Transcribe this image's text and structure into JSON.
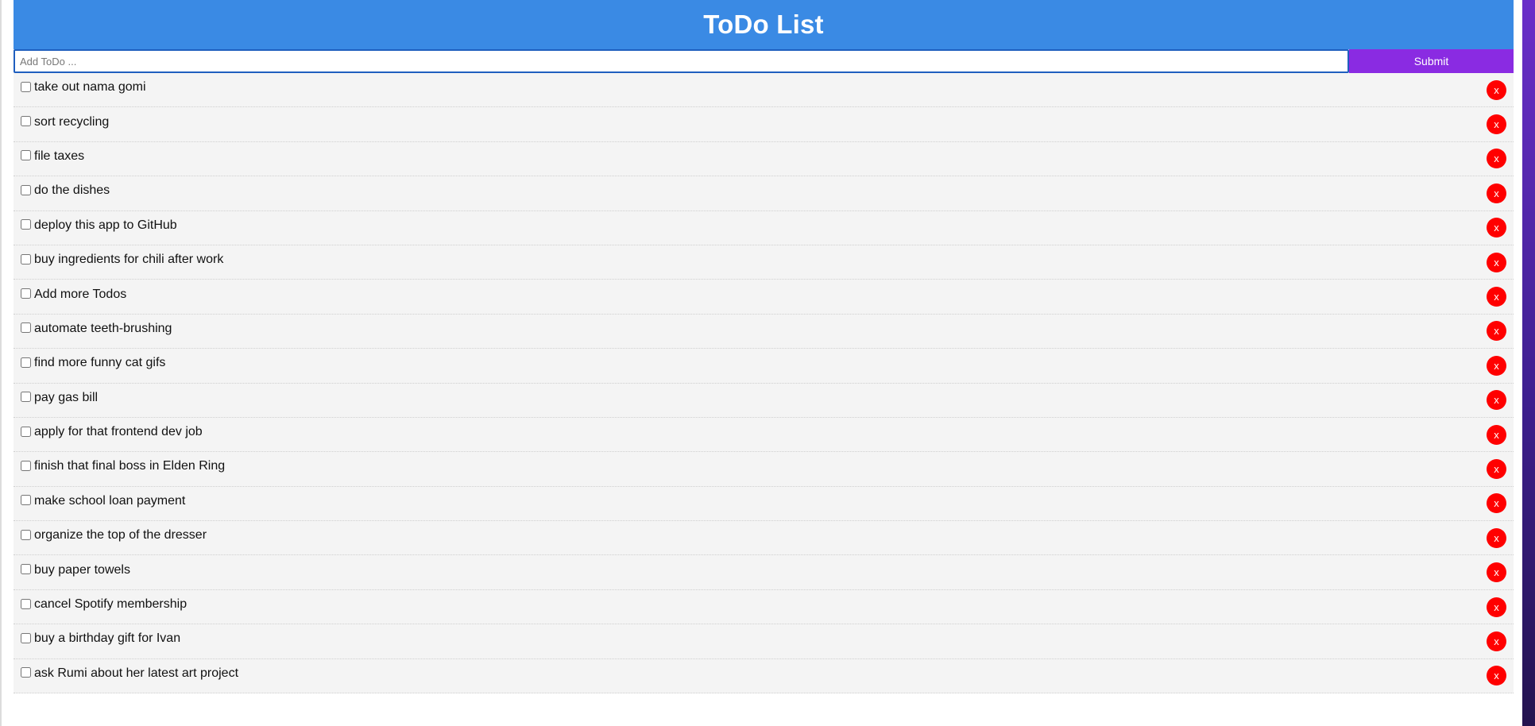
{
  "header": {
    "title": "ToDo List"
  },
  "form": {
    "placeholder": "Add ToDo ...",
    "value": "",
    "submit_label": "Submit"
  },
  "todos": [
    {
      "text": "take out nama gomi",
      "checked": false,
      "delete_label": "x"
    },
    {
      "text": "sort recycling",
      "checked": false,
      "delete_label": "x"
    },
    {
      "text": "file taxes",
      "checked": false,
      "delete_label": "x"
    },
    {
      "text": "do the dishes",
      "checked": false,
      "delete_label": "x"
    },
    {
      "text": "deploy this app to GitHub",
      "checked": false,
      "delete_label": "x"
    },
    {
      "text": "buy ingredients for chili after work",
      "checked": false,
      "delete_label": "x"
    },
    {
      "text": "Add more Todos",
      "checked": false,
      "delete_label": "x"
    },
    {
      "text": "automate teeth-brushing",
      "checked": false,
      "delete_label": "x"
    },
    {
      "text": "find more funny cat gifs",
      "checked": false,
      "delete_label": "x"
    },
    {
      "text": "pay gas bill",
      "checked": false,
      "delete_label": "x"
    },
    {
      "text": "apply for that frontend dev job",
      "checked": false,
      "delete_label": "x"
    },
    {
      "text": "finish that final boss in Elden Ring",
      "checked": false,
      "delete_label": "x"
    },
    {
      "text": "make school loan payment",
      "checked": false,
      "delete_label": "x"
    },
    {
      "text": "organize the top of the dresser",
      "checked": false,
      "delete_label": "x"
    },
    {
      "text": "buy paper towels",
      "checked": false,
      "delete_label": "x"
    },
    {
      "text": "cancel Spotify membership",
      "checked": false,
      "delete_label": "x"
    },
    {
      "text": "buy a birthday gift for Ivan",
      "checked": false,
      "delete_label": "x"
    },
    {
      "text": "ask Rumi about her latest art project",
      "checked": false,
      "delete_label": "x"
    }
  ],
  "colors": {
    "header_bg": "#3a8ae4",
    "submit_bg": "#8a2be2",
    "delete_bg": "#ff0000",
    "row_bg": "#f4f4f4"
  }
}
